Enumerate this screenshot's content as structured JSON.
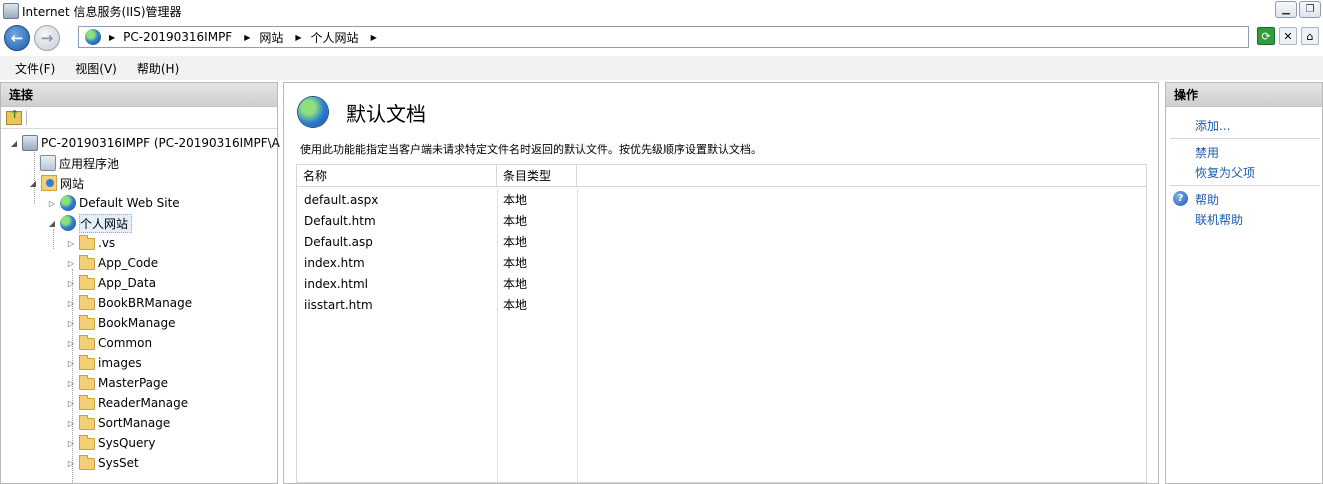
{
  "window": {
    "title": "Internet 信息服务(IIS)管理器"
  },
  "address": {
    "crumbs": [
      "PC-20190316IMPF",
      "网站",
      "个人网站"
    ]
  },
  "menu": {
    "items": [
      "文件(F)",
      "视图(V)",
      "帮助(H)"
    ]
  },
  "connections": {
    "header": "连接",
    "tree": {
      "server": "PC-20190316IMPF (PC-20190316IMPF\\A",
      "app_pools": "应用程序池",
      "sites": "网站",
      "default_site": "Default Web Site",
      "personal_site": "个人网站",
      "folders": [
        ".vs",
        "App_Code",
        "App_Data",
        "BookBRManage",
        "BookManage",
        "Common",
        "images",
        "MasterPage",
        "ReaderManage",
        "SortManage",
        "SysQuery",
        "SysSet"
      ]
    }
  },
  "feature": {
    "title": "默认文档",
    "description": "使用此功能能指定当客户端未请求特定文件名时返回的默认文件。按优先级顺序设置默认文档。",
    "columns": [
      "名称",
      "条目类型"
    ],
    "rows": [
      {
        "name": "default.aspx",
        "type": "本地"
      },
      {
        "name": "Default.htm",
        "type": "本地"
      },
      {
        "name": "Default.asp",
        "type": "本地"
      },
      {
        "name": "index.htm",
        "type": "本地"
      },
      {
        "name": "index.html",
        "type": "本地"
      },
      {
        "name": "iisstart.htm",
        "type": "本地"
      }
    ]
  },
  "actions": {
    "header": "操作",
    "add": "添加...",
    "disable": "禁用",
    "revert": "恢复为父项",
    "help": "帮助",
    "online_help": "联机帮助"
  }
}
